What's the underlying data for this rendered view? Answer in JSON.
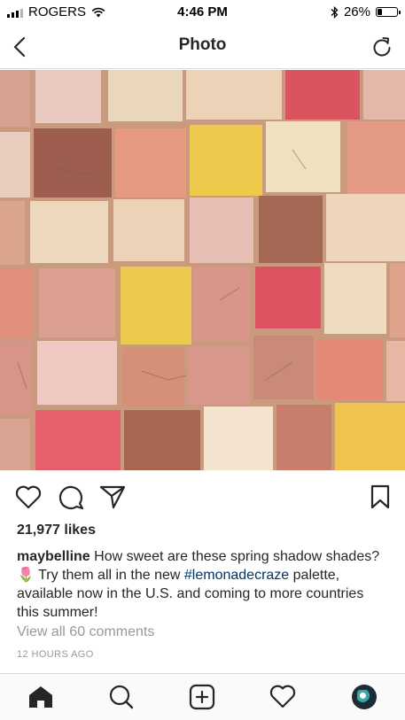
{
  "status_bar": {
    "carrier": "ROGERS",
    "time": "4:46 PM",
    "battery_text": "26%",
    "battery_level": 0.26
  },
  "header": {
    "title": "Photo"
  },
  "post": {
    "likes": "21,977 likes",
    "caption_user": "maybelline",
    "caption_text_1": "How sweet are these spring shadow shades?",
    "caption_emoji": "🌷",
    "caption_text_2": "Try them all in the new",
    "caption_hashtag": "#lemonadecraze",
    "caption_text_3": "palette, available now in the U.S. and coming to more countries this summer!",
    "view_comments": "View all 60 comments",
    "time_ago": "12 HOURS AGO"
  },
  "icons": {
    "back": "chevron-left-icon",
    "refresh": "refresh-icon",
    "like": "heart-outline-icon",
    "comment": "comment-bubble-icon",
    "share": "paper-plane-icon",
    "save": "bookmark-icon",
    "home": "home-icon",
    "search": "search-icon",
    "new_post": "add-post-icon",
    "activity": "heart-outline-icon",
    "profile": "avatar"
  },
  "colors": {
    "hashtag": "#003569",
    "secondary_text": "#999999",
    "divider": "#dbdbdb"
  }
}
